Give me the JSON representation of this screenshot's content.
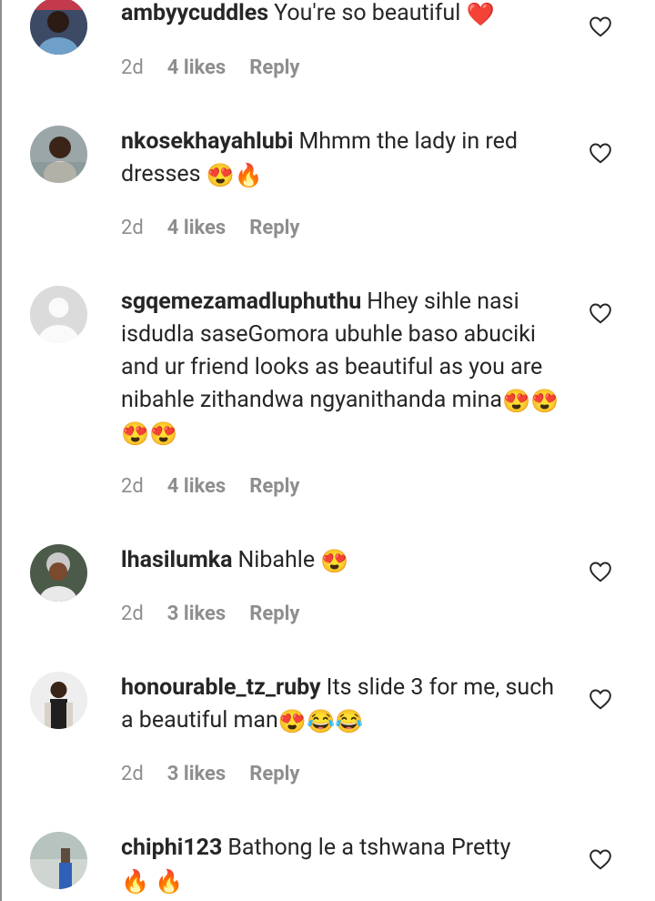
{
  "comments": [
    {
      "username": "ambyycuddles",
      "text": "You're so beautiful",
      "emojis": [
        "❤️"
      ],
      "time": "2d",
      "likes": "4 likes",
      "reply": "Reply"
    },
    {
      "username": "nkosekhayahlubi",
      "text": "Mhmm the lady in red dresses",
      "emojis": [
        "😍",
        "🔥"
      ],
      "time": "2d",
      "likes": "4 likes",
      "reply": "Reply"
    },
    {
      "username": "sgqemezamadluphuthu",
      "text": "Hhey sihle nasi isdudla saseGomora ubuhle baso abuciki and ur friend looks as beautiful as you are nibahle zithandwa ngyanithanda mina",
      "emojis": [
        "😍",
        "😍",
        "😍",
        "😍"
      ],
      "time": "2d",
      "likes": "4 likes",
      "reply": "Reply"
    },
    {
      "username": "lhasilumka",
      "text": "Nibahle",
      "emojis": [
        "😍"
      ],
      "time": "2d",
      "likes": "3 likes",
      "reply": "Reply"
    },
    {
      "username": "honourable_tz_ruby",
      "text": "Its slide 3 for me, such a beautiful man",
      "emojis": [
        "😍",
        "😂",
        "😂"
      ],
      "time": "2d",
      "likes": "3 likes",
      "reply": "Reply"
    },
    {
      "username": "chiphi123",
      "text": "Bathong le a tshwana Pretty",
      "emojis": [
        "🔥",
        "🔥"
      ],
      "time": "",
      "likes": "",
      "reply": ""
    }
  ],
  "icons": {
    "like": "heart-outline-icon",
    "avatar": "avatar-photo"
  },
  "colors": {
    "text": "#262626",
    "meta": "#8e8e8e",
    "heart": "#262626"
  }
}
